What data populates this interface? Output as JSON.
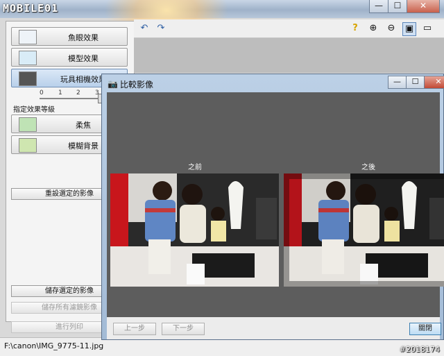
{
  "app": {
    "logo": "MOBILE01"
  },
  "window_buttons": {
    "minimize": "—",
    "maximize": "☐",
    "close": "✕"
  },
  "left_panel": {
    "effects": [
      {
        "label": "魚眼效果",
        "icon": "fisheye-icon"
      },
      {
        "label": "模型效果",
        "icon": "miniature-icon"
      },
      {
        "label": "玩具相機效果",
        "icon": "toy-camera-icon",
        "selected": true
      }
    ],
    "slider_ticks": [
      "0",
      "1",
      "2",
      "3"
    ],
    "level_label": "指定效果等級",
    "effects2": [
      {
        "label": "柔焦",
        "icon": "soft-focus-icon"
      },
      {
        "label": "模糊背景",
        "icon": "blur-background-icon"
      }
    ],
    "reset_label": "重設選定的影像",
    "save_selected_label": "儲存選定的影像",
    "save_all_label": "儲存所有濾鏡影像",
    "print_label": "進行列印"
  },
  "status": {
    "path": "F:\\canon\\IMG_9775-11.jpg",
    "watermark": "#2018174"
  },
  "dialog": {
    "title": "比較影像",
    "before_label": "之前",
    "after_label": "之後",
    "prev_label": "上一步",
    "next_label": "下一步",
    "close_label": "關閉"
  },
  "colors": {
    "dialog_bg": "#5d5d5d",
    "accent": "#6f8fb5"
  }
}
